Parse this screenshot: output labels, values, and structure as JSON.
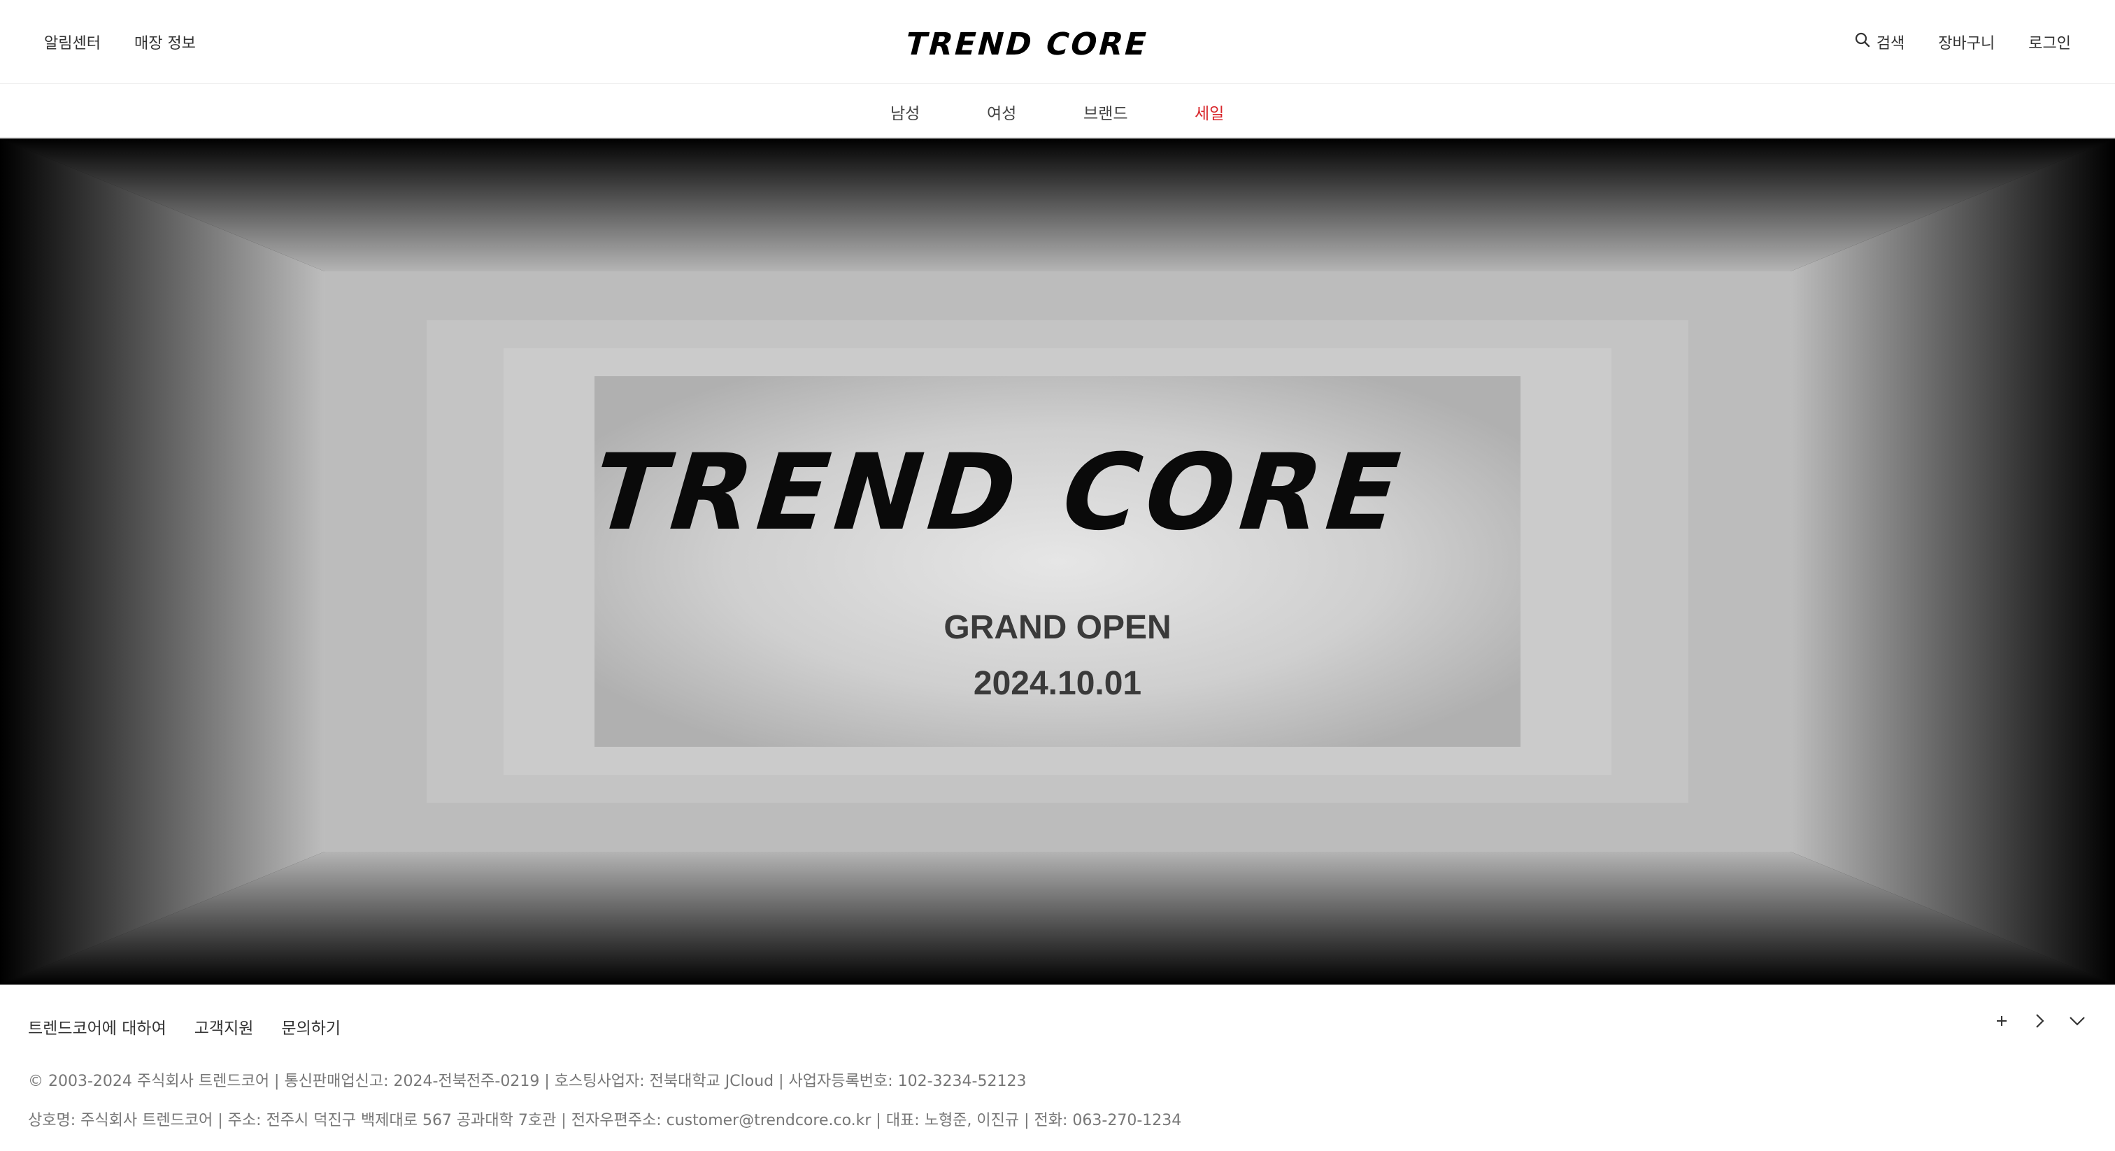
{
  "header": {
    "left_links": [
      "알림센터",
      "매장 정보"
    ],
    "logo": "TREND CORE",
    "right": {
      "search_label": "검색",
      "cart_label": "장바구니",
      "login_label": "로그인"
    },
    "icons": {
      "search": "search-icon"
    }
  },
  "nav": {
    "categories": [
      "남성",
      "여성",
      "브랜드",
      "세일"
    ],
    "sale_color": "#d8262b"
  },
  "hero": {
    "logo": "TREND CORE",
    "headline": "GRAND OPEN",
    "date": "2024.10.01"
  },
  "footer": {
    "links": [
      "트렌드코어에 대하여",
      "고객지원",
      "문의하기"
    ],
    "icons": [
      "plus-icon",
      "chevron-right-icon",
      "chevron-down-icon"
    ],
    "copyright_line": "© 2003-2024 주식회사 트렌드코어 | 통신판매업신고: 2024-전북전주-0219 | 호스팅사업자: 전북대학교 JCloud | 사업자등록번호: 102-3234-52123",
    "company_line": "상호명: 주식회사 트렌드코어 | 주소: 전주시 덕진구 백제대로 567 공과대학 7호관 | 전자우편주소: customer@trendcore.co.kr | 대표: 노형준, 이진규 | 전화: 063-270-1234"
  }
}
